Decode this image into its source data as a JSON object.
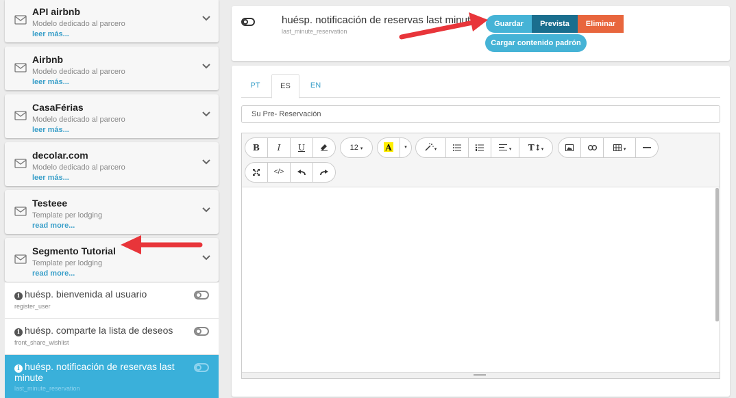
{
  "sidebar": {
    "cards": [
      {
        "title": "API airbnb",
        "subtitle": "Modelo dedicado al parcero",
        "more": "leer más..."
      },
      {
        "title": "Airbnb",
        "subtitle": "Modelo dedicado al parcero",
        "more": "leer más..."
      },
      {
        "title": "CasaFérias",
        "subtitle": "Modelo dedicado al parcero",
        "more": "leer más..."
      },
      {
        "title": "decolar.com",
        "subtitle": "Modelo dedicado al parcero",
        "more": "leer más..."
      },
      {
        "title": "Testeee",
        "subtitle": "Template per lodging",
        "more": "read more..."
      },
      {
        "title": "Segmento Tutorial",
        "subtitle": "Template per lodging",
        "more": "read more..."
      }
    ],
    "templates": [
      {
        "title": "huésp. bienvenida al usuario",
        "key": "register_user"
      },
      {
        "title": "huésp. comparte la lista de deseos",
        "key": "front_share_wishlist"
      },
      {
        "title": "huésp. notificación de reservas last minute",
        "key": "last_minute_reservation"
      }
    ]
  },
  "header": {
    "name": "huésp. notificación de reservas last minute",
    "key": "last_minute_reservation",
    "save_label": "Guardar",
    "preview_label": "Prevista",
    "delete_label": "Eliminar",
    "load_default_label": "Cargar contenido padrón"
  },
  "editor": {
    "tabs": [
      "PT",
      "ES",
      "EN"
    ],
    "active_tab": "ES",
    "subject_value": "Su Pre- Reservación",
    "font_size": "12"
  },
  "colors": {
    "accent": "#45b3d6",
    "preview": "#1a6e8e",
    "delete": "#e8663d",
    "active_item": "#3ab0da",
    "link": "#3a9fc9",
    "arrow": "#e8353a"
  }
}
